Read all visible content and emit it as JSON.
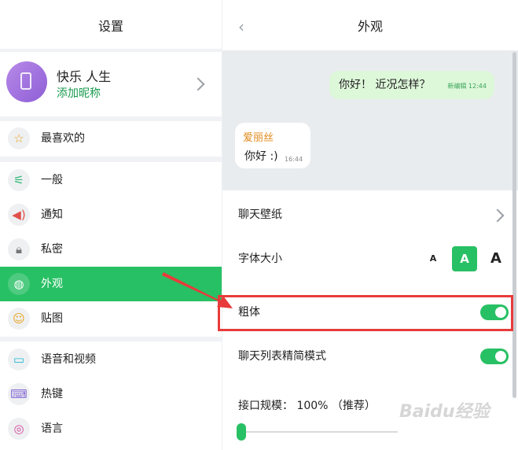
{
  "left": {
    "title": "设置",
    "profile": {
      "name": "快乐 人生",
      "nickname_link": "添加昵称"
    },
    "favorites": {
      "icon": "star-icon",
      "label": "最喜欢的"
    },
    "items": [
      {
        "id": "general",
        "icon": "sliders-icon",
        "label": "一般"
      },
      {
        "id": "notify",
        "icon": "speaker-icon",
        "label": "通知"
      },
      {
        "id": "privacy",
        "icon": "lock-icon",
        "label": "私密"
      },
      {
        "id": "appearance",
        "icon": "palette-icon",
        "label": "外观",
        "active": true
      },
      {
        "id": "stickers",
        "icon": "smiley-icon",
        "label": "贴图"
      }
    ],
    "items2": [
      {
        "id": "voice",
        "icon": "video-icon",
        "label": "语音和视频"
      },
      {
        "id": "hotkeys",
        "icon": "keyboard-icon",
        "label": "热键"
      },
      {
        "id": "language",
        "icon": "globe-icon",
        "label": "语言"
      }
    ]
  },
  "right": {
    "title": "外观",
    "preview": {
      "outgoing": {
        "text": "你好！ 近况怎样？",
        "meta": "新编辑 12:44"
      },
      "incoming": {
        "name": "爱丽丝",
        "text": "你好 :)",
        "time": "16:44"
      }
    },
    "wallpaper_label": "聊天壁纸",
    "font_size_label": "字体大小",
    "font_sizes": [
      "A",
      "A",
      "A"
    ],
    "bold_label": "粗体",
    "bold_on": true,
    "compact_label": "聊天列表精简模式",
    "compact_on": true,
    "scale_label": "接口规模： 100% （推荐）",
    "scale_value_percent": 100
  },
  "watermark": "Baidu经验",
  "colors": {
    "accent": "#28c064",
    "highlight": "#e83b3b"
  }
}
